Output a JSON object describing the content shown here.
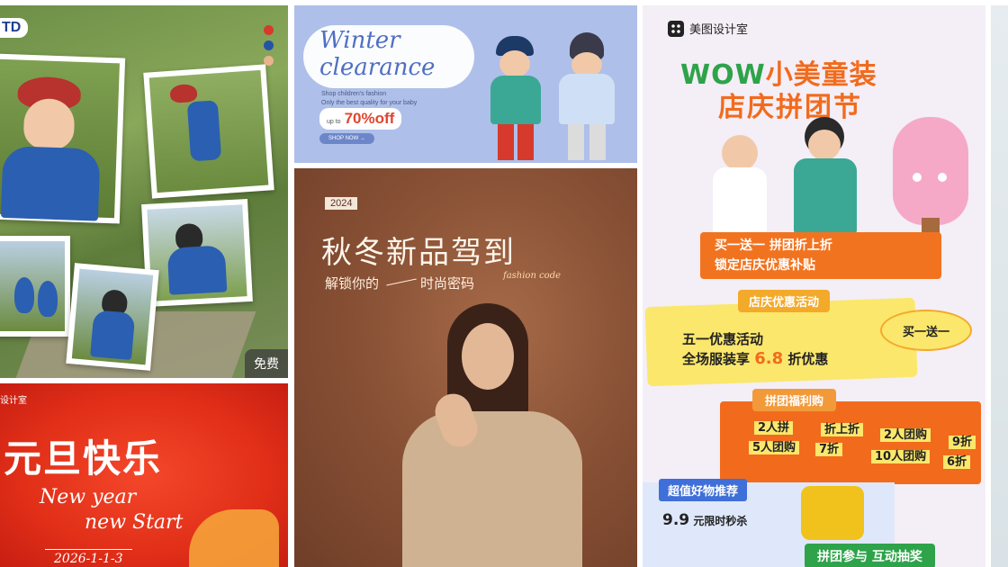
{
  "gallery": {
    "card1": {
      "tag": "TD",
      "swatches": [
        "#d63a2c",
        "#2454a6",
        "#e8b48c"
      ],
      "free_badge": "免费"
    },
    "card2": {
      "title_line1": "Winter",
      "title_line2": "clearance",
      "sub_line1": "Shop children's fashion",
      "sub_line2": "Only the best quality for your baby",
      "upto_small": "up to",
      "upto_big": "70%off",
      "shop_button": "SHOP NOW →"
    },
    "card3": {
      "year": "2024",
      "title": "秋冬新品驾到",
      "sub_left": "解锁你的",
      "sub_right": "时尚密码",
      "script": "fashion code"
    },
    "card4": {
      "brand": "美图设计室",
      "headline_wow": "WOW",
      "headline_rest": "小美童装",
      "headline2": "店庆拼团节",
      "banner_line1": "买一送一  拼团折上折",
      "banner_line2": "锁定店庆优惠补贴",
      "promo_title": "店庆优惠活动",
      "promo_line1": "五一优惠活动",
      "promo_line2_a": "全场服装享",
      "promo_line2_b": "6.8",
      "promo_line2_c": "折优惠",
      "bubble": "买一送一",
      "group_title": "拼团福利购",
      "group_items": [
        "2人拼",
        "折上折",
        "2人团购",
        "9折",
        "5人团购",
        "7折",
        "10人团购",
        "6折"
      ],
      "rec_title": "超值好物推荐",
      "rec_price": "9.9",
      "rec_text": "元限时秒杀",
      "bottom_banner": "拼团参与 互动抽奖"
    },
    "card5": {
      "small": "设计室",
      "big": "元旦快乐",
      "en1": "New year",
      "en2": "new Start",
      "date": "2026-1-1-3"
    }
  }
}
